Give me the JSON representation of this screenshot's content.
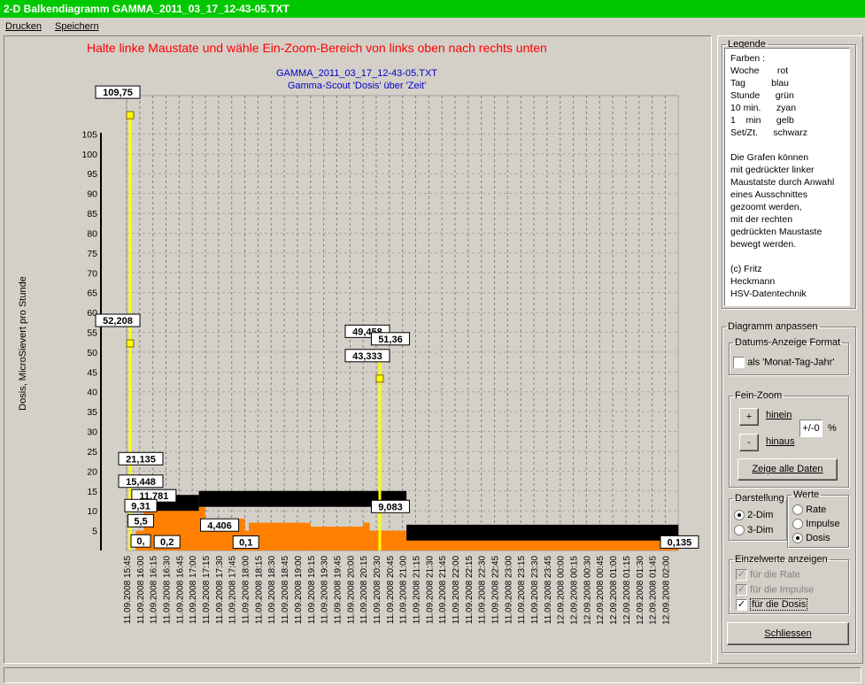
{
  "window": {
    "title": "2-D Balkendiagramm GAMMA_2011_03_17_12-43-05.TXT"
  },
  "menu": [
    {
      "label": "Drucken"
    },
    {
      "label": "Speichern"
    }
  ],
  "hint": "Halte linke Maustate und wähle Ein-Zoom-Bereich von links oben nach rechts unten",
  "chart_data": {
    "type": "bar",
    "title": "GAMMA_2011_03_17_12-43-05.TXT",
    "subtitle": "Gamma-Scout 'Dosis' über 'Zeit'",
    "ylabel": "Dosis, MicroSievert pro Stunde",
    "ylim": [
      0,
      110
    ],
    "yticks": [
      5,
      10,
      15,
      20,
      25,
      30,
      35,
      40,
      45,
      50,
      55,
      60,
      65,
      70,
      75,
      80,
      85,
      90,
      95,
      100,
      105
    ],
    "x_tick_labels": [
      "11.09.2008 15:45",
      "11.09.2008 16:00",
      "11.09.2008 16:15",
      "11.09.2008 16:30",
      "11.09.2008 16:45",
      "11.09.2008 17:00",
      "11.09.2008 17:15",
      "11.09.2008 17:30",
      "11.09.2008 17:45",
      "11.09.2008 18:00",
      "11.09.2008 18:15",
      "11.09.2008 18:30",
      "11.09.2008 18:45",
      "11.09.2008 19:00",
      "11.09.2008 19:15",
      "11.09.2008 19:30",
      "11.09.2008 19:45",
      "11.09.2008 20:00",
      "11.09.2008 20:15",
      "11.09.2008 20:30",
      "11.09.2008 20:45",
      "11.09.2008 21:00",
      "11.09.2008 21:15",
      "11.09.2008 21:30",
      "11.09.2008 21:45",
      "11.09.2008 22:00",
      "11.09.2008 22:15",
      "11.09.2008 22:30",
      "11.09.2008 22:45",
      "11.09.2008 23:00",
      "11.09.2008 23:15",
      "11.09.2008 23:30",
      "11.09.2008 23:45",
      "12.09.2008 00:00",
      "12.09.2008 00:15",
      "12.09.2008 00:30",
      "12.09.2008 00:45",
      "12.09.2008 01:00",
      "12.09.2008 01:15",
      "12.09.2008 01:30",
      "12.09.2008 01:45",
      "12.09.2008 02:00"
    ],
    "grid": true,
    "series": [
      {
        "name": "Dosis",
        "color": "#ffff00",
        "points": [
          {
            "x": "11.09.2008 15:45",
            "y": 109.75,
            "label": "109,75"
          },
          {
            "x": "11.09.2008 15:45",
            "y": 52.208,
            "label": "52,208"
          },
          {
            "x": "11.09.2008 20:30",
            "y": 49.458,
            "label": "49,458"
          },
          {
            "x": "11.09.2008 20:30",
            "y": 43.333,
            "label": "43,333"
          }
        ]
      }
    ],
    "annotations": [
      {
        "x": "11.09.2008 20:30",
        "y": 51.36,
        "label": "51,36"
      },
      {
        "x": "11.09.2008 15:45",
        "y": 21.135,
        "label": "21,135"
      },
      {
        "x": "11.09.2008 15:45",
        "y": 15.448,
        "label": "15,448"
      },
      {
        "x": "11.09.2008 16:00",
        "y": 11.781,
        "label": "11,781"
      },
      {
        "x": "11.09.2008 15:45",
        "y": 9.31,
        "label": "9,31"
      },
      {
        "x": "11.09.2008 15:45",
        "y": 5.5,
        "label": "5,5"
      },
      {
        "x": "11.09.2008 15:45",
        "y": 0.4,
        "label": "0,"
      },
      {
        "x": "11.09.2008 16:15",
        "y": 0.2,
        "label": "0,2"
      },
      {
        "x": "11.09.2008 17:15",
        "y": 4.406,
        "label": "4,406"
      },
      {
        "x": "11.09.2008 17:45",
        "y": 0.1,
        "label": "0,1"
      },
      {
        "x": "11.09.2008 20:30",
        "y": 9.083,
        "label": "9,083"
      },
      {
        "x": "12.09.2008 02:00",
        "y": 0.135,
        "label": "0,135"
      }
    ],
    "legend": "right"
  },
  "legende": {
    "title": "Legende",
    "text": "Farben :\nWoche       rot\nTag          blau\nStunde      grün\n10 min.      zyan\n1    min      gelb\nSet/Zt.      schwarz\n\nDie Grafen können\nmit gedrückter linker\nMaustatste durch Anwahl\neines Ausschnittes\ngezoomt werden,\nmit der rechten\ngedrückten Maustaste\nbewegt werden.\n\n(c) Fritz\nHeckmann\nHSV-Datentechnik"
  },
  "anpassen": {
    "title": "Diagramm anpassen",
    "datum_group": "Datums-Anzeige Format",
    "datum_check": "als 'Monat-Tag-Jahr'",
    "zoom_group": "Fein-Zoom",
    "plus": "+",
    "minus": "-",
    "hinein": "hinein",
    "hinaus": "hinaus",
    "zoom_value": "+/-0",
    "percent": "%",
    "show_all": "Zeige alle Daten",
    "darstellung_group": "Darstellung",
    "dim2": "2-Dim",
    "dim3": "3-Dim",
    "werte_group": "Werte",
    "rate": "Rate",
    "impulse": "Impulse",
    "dosis": "Dosis",
    "einzel_group": "Einzelwerte anzeigen",
    "fuer_rate": "für die Rate",
    "fuer_impulse": "für die Impulse",
    "fuer_dosis": "für die Dosis",
    "close": "Schliessen"
  },
  "colors": {
    "title_bar": "#00c800",
    "hint": "#ff0000",
    "dose_line": "#ffff00",
    "bars": "#ff8000"
  }
}
